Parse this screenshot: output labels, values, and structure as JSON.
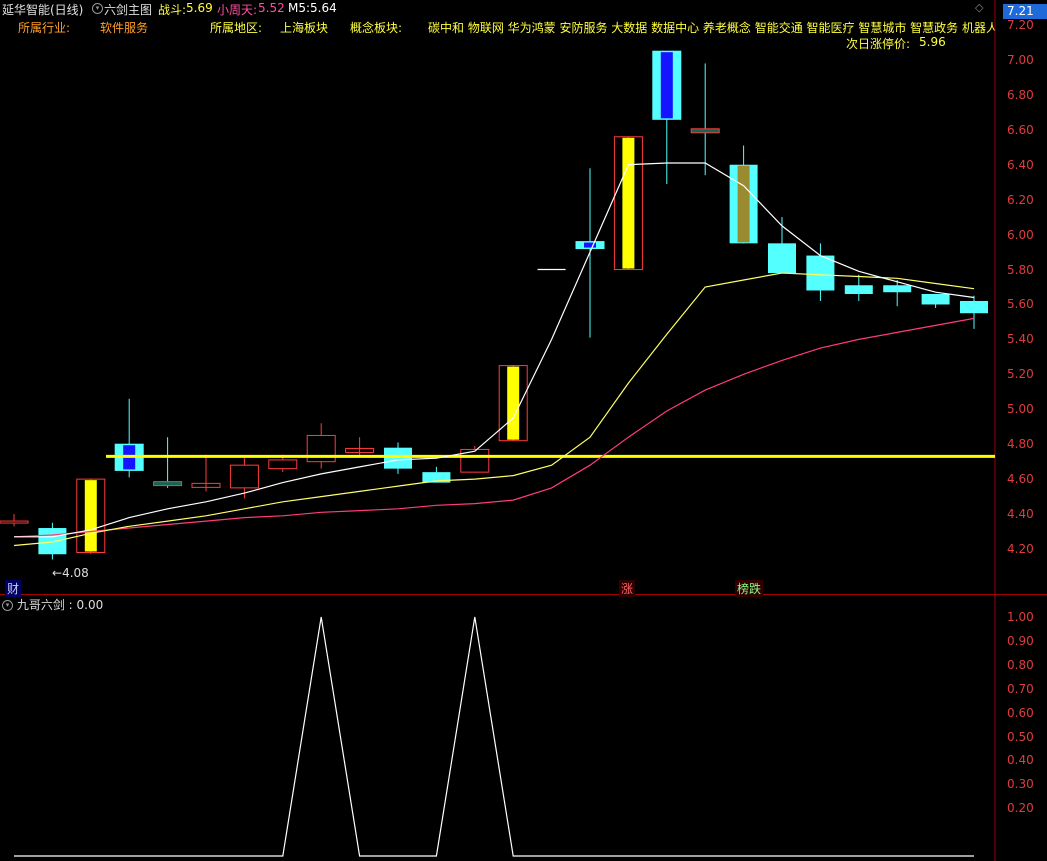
{
  "header": {
    "stock_title": "延华智能(日线)",
    "main_indicator": "六剑主图",
    "items": [
      {
        "label": "战斗:",
        "value": "5.69",
        "color": "#ffff40"
      },
      {
        "label": "小周天:",
        "value": "5.52",
        "color": "#ff4fa0"
      },
      {
        "label": "M5:",
        "value": "5.64",
        "color": "#ffffff"
      }
    ],
    "price_badge": "7.21"
  },
  "info": {
    "industry_label": "所属行业:",
    "industry_value": "软件服务",
    "region_label": "所属地区:",
    "region_value": "上海板块",
    "concept_label": "概念板块:",
    "concept_value": "碳中和 物联网 华为鸿蒙 安防服务 大数据 数据中心 养老概念 智能交通 智能医疗 智慧城市 智慧政务 机器人概",
    "limit_label": "次日涨停价:",
    "limit_value": "5.96"
  },
  "main_axis_ticks": [
    "7.20",
    "7.00",
    "6.80",
    "6.60",
    "6.40",
    "6.20",
    "6.00",
    "5.80",
    "5.60",
    "5.40",
    "5.20",
    "5.00",
    "4.80",
    "4.60",
    "4.40",
    "4.20"
  ],
  "low_label": "4.08",
  "tags": {
    "cai": "财",
    "zhang": "涨",
    "bang": "榜跌"
  },
  "sub_panel": {
    "title": "九哥六剑",
    "value": "0.00",
    "ticks": [
      "1.00",
      "0.90",
      "0.80",
      "0.70",
      "0.60",
      "0.50",
      "0.40",
      "0.30",
      "0.20"
    ]
  },
  "colors": {
    "up": "#ff3c3c",
    "down": "#54ffff",
    "yellow": "#ffff00",
    "blue": "#1414ff",
    "ma_white": "#ffffff",
    "ma_yellow": "#ffff66",
    "ma_pink": "#ff3c7a"
  },
  "chart_data": {
    "type": "candlestick",
    "ylim": [
      4.08,
      7.21
    ],
    "candles": [
      {
        "o": 4.35,
        "h": 4.4,
        "l": 4.33,
        "c": 4.36,
        "style": "down"
      },
      {
        "o": 4.32,
        "h": 4.35,
        "l": 4.14,
        "c": 4.17,
        "style": "down"
      },
      {
        "o": 4.18,
        "h": 4.6,
        "l": 4.17,
        "c": 4.6,
        "style": "yellow"
      },
      {
        "o": 4.8,
        "h": 5.06,
        "l": 4.61,
        "c": 4.65,
        "style": "blue"
      },
      {
        "o": 4.58,
        "h": 4.84,
        "l": 4.55,
        "c": 4.57,
        "style": "downthin"
      },
      {
        "o": 4.55,
        "h": 4.74,
        "l": 4.53,
        "c": 4.57,
        "style": "downthin"
      },
      {
        "o": 4.55,
        "h": 4.72,
        "l": 4.49,
        "c": 4.68,
        "style": "up"
      },
      {
        "o": 4.66,
        "h": 4.74,
        "l": 4.64,
        "c": 4.71,
        "style": "up"
      },
      {
        "o": 4.7,
        "h": 4.92,
        "l": 4.66,
        "c": 4.85,
        "style": "up"
      },
      {
        "o": 4.76,
        "h": 4.84,
        "l": 4.73,
        "c": 4.77,
        "style": "downthin"
      },
      {
        "o": 4.78,
        "h": 4.81,
        "l": 4.63,
        "c": 4.66,
        "style": "down"
      },
      {
        "o": 4.64,
        "h": 4.67,
        "l": 4.58,
        "c": 4.58,
        "style": "down"
      },
      {
        "o": 4.64,
        "h": 4.79,
        "l": 4.64,
        "c": 4.77,
        "style": "up"
      },
      {
        "o": 4.82,
        "h": 5.25,
        "l": 4.82,
        "c": 5.25,
        "style": "yellow"
      },
      {
        "o": 5.8,
        "h": 5.8,
        "l": 5.8,
        "c": 5.8,
        "style": "flat"
      },
      {
        "o": 5.96,
        "h": 6.38,
        "l": 5.41,
        "c": 5.92,
        "style": "blue"
      },
      {
        "o": 5.8,
        "h": 6.56,
        "l": 5.8,
        "c": 6.56,
        "style": "yellow"
      },
      {
        "o": 7.05,
        "h": 7.05,
        "l": 6.29,
        "c": 6.66,
        "style": "blue"
      },
      {
        "o": 6.6,
        "h": 6.98,
        "l": 6.34,
        "c": 6.58,
        "style": "downthin"
      },
      {
        "o": 6.4,
        "h": 6.51,
        "l": 5.95,
        "c": 5.95,
        "style": "cyanbrown"
      },
      {
        "o": 5.95,
        "h": 6.1,
        "l": 5.78,
        "c": 5.78,
        "style": "up"
      },
      {
        "o": 5.88,
        "h": 5.95,
        "l": 5.62,
        "c": 5.68,
        "style": "down"
      },
      {
        "o": 5.71,
        "h": 5.77,
        "l": 5.62,
        "c": 5.66,
        "style": "up"
      },
      {
        "o": 5.71,
        "h": 5.74,
        "l": 5.59,
        "c": 5.67,
        "style": "down"
      },
      {
        "o": 5.66,
        "h": 5.66,
        "l": 5.58,
        "c": 5.6,
        "style": "down"
      },
      {
        "o": 5.62,
        "h": 5.65,
        "l": 5.46,
        "c": 5.55,
        "style": "down"
      }
    ],
    "lines": {
      "support_level": 4.73,
      "ma_white": [
        4.27,
        4.27,
        4.31,
        4.38,
        4.43,
        4.47,
        4.52,
        4.58,
        4.63,
        4.67,
        4.71,
        4.72,
        4.76,
        4.95,
        5.4,
        5.9,
        6.4,
        6.41,
        6.41,
        6.28,
        6.05,
        5.88,
        5.79,
        5.73,
        5.67,
        5.64
      ],
      "ma_yellow": [
        4.22,
        4.24,
        4.29,
        4.33,
        4.36,
        4.39,
        4.43,
        4.47,
        4.5,
        4.53,
        4.56,
        4.59,
        4.6,
        4.62,
        4.68,
        4.84,
        5.15,
        5.43,
        5.7,
        5.74,
        5.78,
        5.77,
        5.76,
        5.75,
        5.72,
        5.69
      ],
      "ma_pink": [
        4.27,
        4.28,
        4.3,
        4.32,
        4.34,
        4.36,
        4.38,
        4.39,
        4.41,
        4.42,
        4.43,
        4.45,
        4.46,
        4.48,
        4.55,
        4.68,
        4.84,
        4.99,
        5.11,
        5.2,
        5.28,
        5.35,
        5.4,
        5.44,
        5.48,
        5.52
      ]
    },
    "sub_series": [
      0,
      0,
      0,
      0,
      0,
      0,
      0,
      0,
      1,
      0,
      0,
      0,
      1,
      0,
      0,
      0,
      0,
      0,
      0,
      0,
      0,
      0,
      0,
      0,
      0,
      0
    ]
  }
}
